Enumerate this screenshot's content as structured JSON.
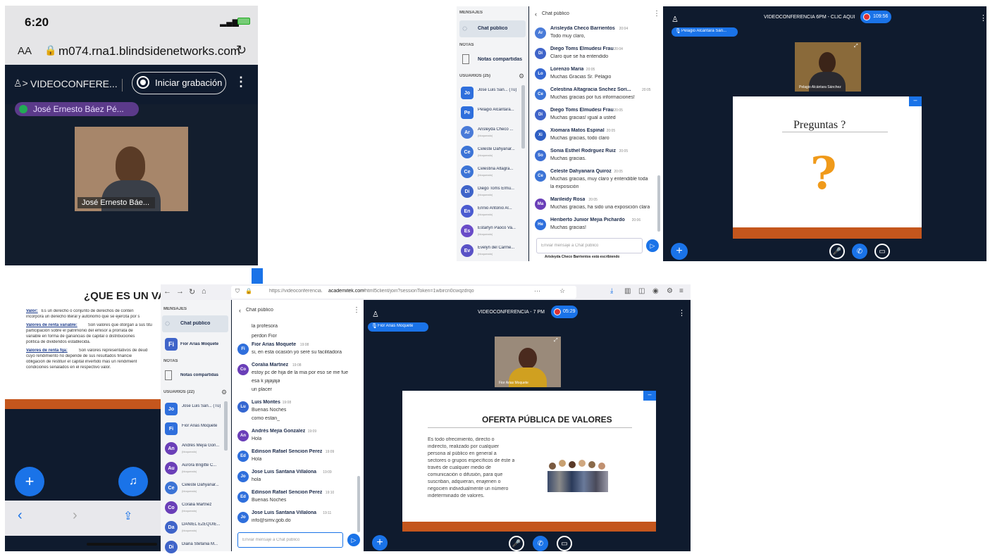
{
  "phone": {
    "time": "6:20",
    "text_size": "AA",
    "url": "m074.rna1.blindsidenetworks.com",
    "conference_title": "VIDEOCONFERE...",
    "record_label": "Iniciar grabación",
    "presenter_pill": "José Ernesto Báez Pé...",
    "camera_name": "José Ernesto Báe..."
  },
  "tr": {
    "sidebar": {
      "messages_header": "MENSAJES",
      "public_chat": "Chat público",
      "notes_header": "NOTAS",
      "shared_notes": "Notas compartidas",
      "users_header": "USUARIOS (25)",
      "users": [
        {
          "initials": "Jo",
          "name": "Jose Luis San... (Tú)",
          "sub": "",
          "color": "#2f6fdc",
          "square": true
        },
        {
          "initials": "Pe",
          "name": "Pelagio Alcántara...",
          "sub": "",
          "color": "#2f6fdc",
          "square": true
        },
        {
          "initials": "Ar",
          "name": "Arisleyda Checo ...",
          "sub": "(bloqueado)",
          "color": "#4a7bd8",
          "square": false
        },
        {
          "initials": "Ce",
          "name": "Celeste Dahyanar...",
          "sub": "(bloqueado)",
          "color": "#3c74d6",
          "square": false
        },
        {
          "initials": "Ce",
          "name": "Celestina Altagra...",
          "sub": "(bloqueado)",
          "color": "#3c74d6",
          "square": false
        },
        {
          "initials": "Di",
          "name": "Diego Toms Elmu...",
          "sub": "(bloqueado)",
          "color": "#3f64c9",
          "square": false
        },
        {
          "initials": "En",
          "name": "Ennio Antonio Al...",
          "sub": "(bloqueado)",
          "color": "#4b5bd0",
          "square": false
        },
        {
          "initials": "Es",
          "name": "Estarlyn Paoco Va...",
          "sub": "(bloqueado)",
          "color": "#6a4cc8",
          "square": false
        },
        {
          "initials": "Ev",
          "name": "Evelyn del Carme...",
          "sub": "(bloqueado)",
          "color": "#5a52c6",
          "square": false
        }
      ]
    },
    "chat": {
      "title": "Chat público",
      "messages": [
        {
          "initials": "Ar",
          "name": "Arisleyda Checo Barrientos",
          "time": "20:04",
          "text": "Todo muy claro,",
          "color": "#4a7bd8"
        },
        {
          "initials": "Di",
          "name": "Diego Toms Elmudesi Frau",
          "time": "20:04",
          "text": "Claro que se ha entendido",
          "color": "#3f64c9"
        },
        {
          "initials": "Lo",
          "name": "Lorenzo Maria",
          "time": "20:05",
          "text": "Muchas Gracias Sr. Pelagio",
          "color": "#3567d1"
        },
        {
          "initials": "Ce",
          "name": "Celestina Altagracia Snchez Sori...",
          "time": "20:05",
          "text": "Muchas gracias por tus informaciones!",
          "color": "#3c74d6"
        },
        {
          "initials": "Di",
          "name": "Diego Toms Elmudesi Frau",
          "time": "20:05",
          "text": "Muchas gracias! igual a usted",
          "color": "#3f64c9"
        },
        {
          "initials": "Xi",
          "name": "Xiomara Matos Espinal",
          "time": "20:05",
          "text": "Muchas gracias, todo claro",
          "color": "#2f5fc4"
        },
        {
          "initials": "So",
          "name": "Sonia Esthel Rodrguez Ruiz",
          "time": "20:05",
          "text": "Muchas gracias.",
          "color": "#3c6fd4"
        },
        {
          "initials": "Ce",
          "name": "Celeste Dahyanara Quiroz",
          "time": "20:05",
          "text": "Muchas gracias, muy claro y entendible toda",
          "text2": "la exposición",
          "color": "#3c74d6"
        },
        {
          "initials": "Ma",
          "name": "Marileidy Rosa",
          "time": "20:05",
          "text": "Muchas gracias, ha sido una exposición clara",
          "color": "#6a3fb8"
        },
        {
          "initials": "He",
          "name": "Heriberto Junior Mejia Pichardo",
          "time": "20:06",
          "text": "Muchas gracias!",
          "color": "#2f6fdc"
        }
      ],
      "placeholder": "Enviar mensaje a Chat público",
      "typing": "Arisleyda Checo Barrientos está escribiendo"
    },
    "main": {
      "title": "VIDEOCONFERENCIA 6PM - CLIC AQUI",
      "timer": "109:56",
      "presenter_pill": "Pelagio Alcántara Sán...",
      "camera_name": "Pelagio Alcántara Sánchez",
      "slide_title": "Preguntas ?"
    }
  },
  "bl": {
    "slide_title": "¿QUE ES UN VALO",
    "bullets": [
      {
        "label": "Valor:",
        "text": "Es un derecho o conjunto de derechos de conten",
        "text2": "incorpora un derecho literal y autónomo que se ejercita por s"
      },
      {
        "label": "Valores de renta variable:",
        "text": "Son valores que otorgan a sus titu",
        "text2": "participación sobre el patrimonio del emisor a prorrata de",
        "text3": "variable en forma de ganancias de capital o distribuciones",
        "text4": "política de dividendos establecida."
      },
      {
        "label": "Valores de renta fija:",
        "text": "Son valores representativos de deud",
        "text2": "cuyo rendimiento no depende de sus resultados financie",
        "text3": "obligación de restituir el capital invertido más un rendimient",
        "text4": "condiciones señalados en el respectivo valor."
      }
    ]
  },
  "br": {
    "browser": {
      "url_prefix": "https://videoconferencia.",
      "url_domain": "academitek.com",
      "url_rest": "/html5client/join?sessionToken=1wbircn0cwqzdrqo",
      "menu_dots": "···"
    },
    "sidebar": {
      "messages_header": "MENSAJES",
      "public_chat": "Chat público",
      "private_chat": "Fior Arias Moquete",
      "notes_header": "NOTAS",
      "shared_notes": "Notas compartidas",
      "users_header": "USUARIOS (22)",
      "users": [
        {
          "initials": "Jo",
          "name": "Jose Luis San... (Tú)",
          "sub": "",
          "color": "#2f6fdc",
          "square": true
        },
        {
          "initials": "Fi",
          "name": "Fior Arias Moquete",
          "sub": "",
          "color": "#2f6fdc",
          "square": true
        },
        {
          "initials": "An",
          "name": "Andrés Mejía Gon...",
          "sub": "(bloqueado)",
          "color": "#6a3fb8",
          "square": false
        },
        {
          "initials": "Au",
          "name": "Aurora Brigitte C...",
          "sub": "(bloqueado)",
          "color": "#6a3fb8",
          "square": false
        },
        {
          "initials": "Ce",
          "name": "Celeste Dahyanar...",
          "sub": "(bloqueado)",
          "color": "#3c74d6",
          "square": false
        },
        {
          "initials": "Co",
          "name": "Coralia Martnez",
          "sub": "(bloqueado)",
          "color": "#6a3fb8",
          "square": false
        },
        {
          "initials": "Da",
          "name": "DANIEL EZEQUIE...",
          "sub": "(bloqueado)",
          "color": "#3f64c9",
          "square": false
        },
        {
          "initials": "Di",
          "name": "Diana Stefania M...",
          "sub": "",
          "color": "#3f64c9",
          "square": false
        }
      ]
    },
    "chat": {
      "title": "Chat público",
      "pre": [
        "la profesora",
        "perdon Fior"
      ],
      "messages": [
        {
          "initials": "Fi",
          "name": "Fior Arias Moquete",
          "time": "19:08",
          "lines": [
            "si, en esta ocasión yo seré su facilitadora"
          ],
          "color": "#2f6fdc"
        },
        {
          "initials": "Co",
          "name": "Coralia Martnez",
          "time": "19:08",
          "lines": [
            "estoy pc de hija de la mia por eso se me fue",
            "esa k jajajaja",
            "un placer"
          ],
          "color": "#6a3fb8"
        },
        {
          "initials": "Lu",
          "name": "Luis Montes",
          "time": "19:08",
          "lines": [
            "Buenas Noches",
            "como estan_"
          ],
          "color": "#3567d1"
        },
        {
          "initials": "An",
          "name": "Andrés Mejía Gonzalez",
          "time": "19:09",
          "lines": [
            "Hola"
          ],
          "color": "#6a3fb8"
        },
        {
          "initials": "Ed",
          "name": "Edinson Rafael Sencion Perez",
          "time": "19:09",
          "lines": [
            "Hola"
          ],
          "color": "#2f6fdc"
        },
        {
          "initials": "Jo",
          "name": "Jose Luis Santana Villalona",
          "time": "19:09",
          "lines": [
            "hola"
          ],
          "color": "#2f6fdc"
        },
        {
          "initials": "Ed",
          "name": "Edinson Rafael Sencion Perez",
          "time": "19:10",
          "lines": [
            "Buenas Noches"
          ],
          "color": "#2f6fdc"
        },
        {
          "initials": "Jo",
          "name": "Jose Luis Santana Villalona",
          "time": "19:11",
          "lines": [
            "info@simv.gob.do"
          ],
          "color": "#2f6fdc"
        }
      ],
      "placeholder": "Enviar mensaje a Chat público"
    },
    "main": {
      "title": "VIDEOCONFERENCIA - 7 PM",
      "timer": "05:29",
      "presenter_pill": "Fior Arias Moquete",
      "camera_name": "Fior Arias Moquete",
      "slide_title": "OFERTA PÚBLICA DE VALORES",
      "slide_lines": [
        "Es  todo  ofrecimiento,  directo  o",
        "indirecto,  realizado  por  cualquier",
        "persona  al  público  en  general  a",
        "sectores o grupos específicos de éste a",
        "través   de   cualquier   medio   de",
        "comunicación  o  difusión,  para  que",
        "suscriban,   adquieran,   enajenen   o",
        "negocien  individualmente  un  número",
        "indeterminado de valores."
      ]
    }
  },
  "colors": {
    "dark_bg": "#0f1b2e",
    "accent_blue": "#1a73e8",
    "sidebar_bg": "#f3f4f6",
    "slide_bar": "#c4561d"
  }
}
